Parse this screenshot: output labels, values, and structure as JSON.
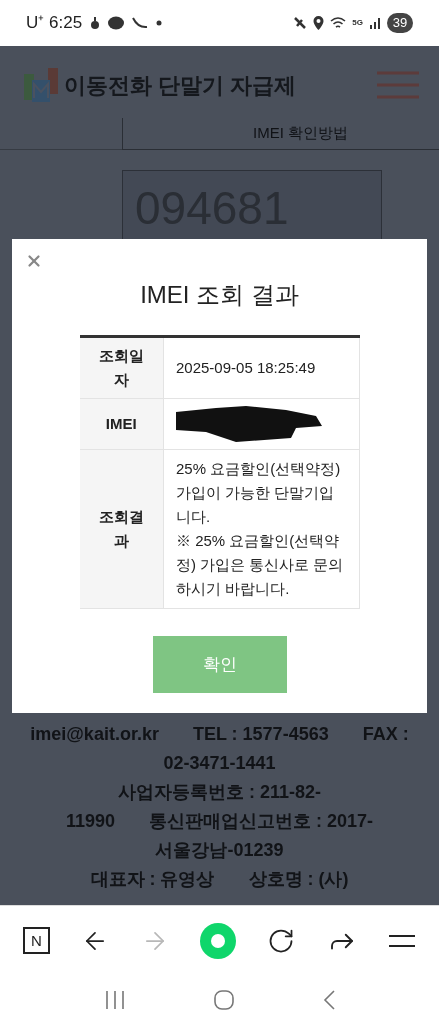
{
  "status_bar": {
    "carrier": "U⁺",
    "time": "6:25",
    "network": "5G",
    "battery": "39"
  },
  "header": {
    "title": "이동전화 단말기 자급제"
  },
  "tab": {
    "label": "IMEI 확인방법"
  },
  "captcha": {
    "code": "094681"
  },
  "dialog": {
    "title": "IMEI 조회 결과",
    "rows": [
      {
        "kind": "text",
        "label": "조회일자",
        "value": [
          "2025-09-05 18:25:49"
        ]
      },
      {
        "kind": "redacted",
        "label": "IMEI"
      },
      {
        "kind": "text",
        "label": "조회결과",
        "value": [
          "25% 요금할인(선택약정) 가입이 가능한 단말기입니다.",
          "※ 25% 요금할인(선택약정) 가입은 통신사로 문의하시기 바랍니다."
        ]
      }
    ],
    "button": "확인"
  },
  "footer": {
    "lines": [
      [
        "imei@kait.or.kr",
        "TEL : 1577-4563",
        "FAX :"
      ],
      [
        "02-3471-1441"
      ],
      [
        "사업자등록번호 : 211-82-"
      ],
      [
        "11990",
        "통신판매업신고번호 : 2017-"
      ],
      [
        "서울강남-01239"
      ],
      [
        "대표자 : 유영상",
        "상호명 : (사)"
      ]
    ]
  },
  "browser_toolbar": [
    {
      "kind": "naver",
      "label": "N",
      "disabled": false
    },
    {
      "kind": "back",
      "disabled": false
    },
    {
      "kind": "forward",
      "disabled": true
    },
    {
      "kind": "green",
      "disabled": false
    },
    {
      "kind": "reload",
      "disabled": false
    },
    {
      "kind": "share",
      "disabled": false
    },
    {
      "kind": "menu",
      "disabled": false
    }
  ]
}
